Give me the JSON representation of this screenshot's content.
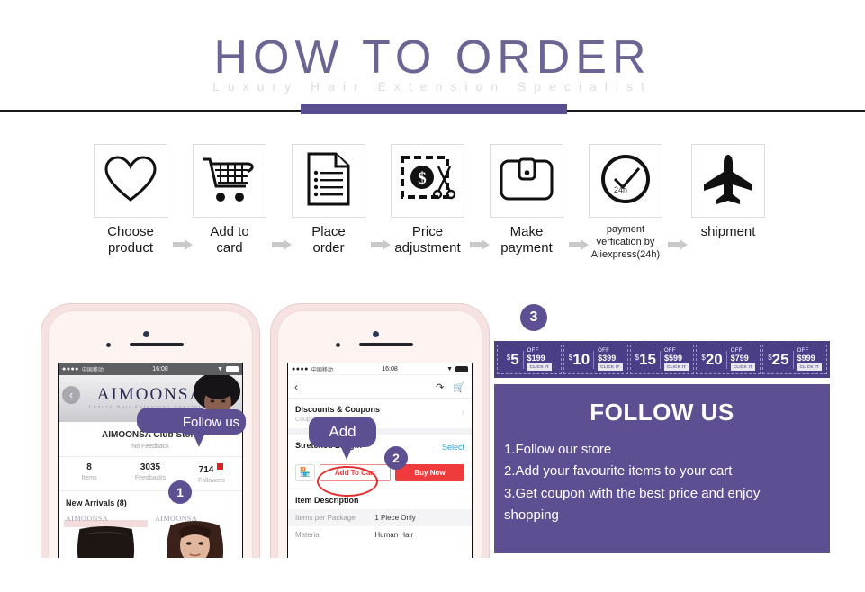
{
  "header": {
    "title": "HOW TO ORDER",
    "subtitle": "Luxury Hair Extension Specialist"
  },
  "steps": [
    {
      "icon": "heart-icon",
      "label_line1": "Choose",
      "label_line2": "product"
    },
    {
      "icon": "cart-icon",
      "label_line1": "Add to",
      "label_line2": "card"
    },
    {
      "icon": "document-icon",
      "label_line1": "Place",
      "label_line2": "order"
    },
    {
      "icon": "price-cut-icon",
      "label_line1": "Price",
      "label_line2": "adjustment"
    },
    {
      "icon": "wallet-icon",
      "label_line1": "Make",
      "label_line2": "payment"
    },
    {
      "icon": "clock-check-icon",
      "label_line1": "payment",
      "label_line2": "verfication by",
      "label_line3": "Aliexpress(24h)",
      "inner_text": "24h"
    },
    {
      "icon": "airplane-icon",
      "label_line1": "shipment",
      "label_line2": ""
    }
  ],
  "phone1": {
    "status_bar": {
      "dots": "●●●●",
      "carrier": "中国移动",
      "time": "16:08",
      "wifi": "▼"
    },
    "hero": {
      "back_icon": "back-chevron-icon",
      "brand": "AIMOONSA",
      "brand_sub": "Luxury Hair Extension Specialist"
    },
    "store_name": "AIMOONSA Club Store",
    "feedback": "No Feedback",
    "stats": [
      {
        "num": "8",
        "cap": "Items"
      },
      {
        "num": "3035",
        "cap": "Feedbacks"
      },
      {
        "num": "714",
        "cap": "Followers"
      }
    ],
    "new_arrivals": "New Arrivals (8)",
    "tile_watermark": "AIMOONSA",
    "bubble": "Follow us",
    "step_number": "1"
  },
  "phone2": {
    "status_bar": {
      "dots": "●●●●",
      "carrier": "中国移动",
      "time": "16:08",
      "wifi": "▼"
    },
    "back_icon": "back-chevron-icon",
    "share_icon": "share-icon",
    "cart_icon": "cart-icon",
    "discounts_title": "Discounts & Coupons",
    "discounts_sub": "Coupons",
    "stretched_title": "Stretched Length",
    "select_label": "Select",
    "shop_icon": "shop-icon",
    "add_to_cart": "Add To Cart",
    "buy_now": "Buy Now",
    "item_description": "Item Description",
    "desc_rows": [
      {
        "key": "Items per Package",
        "value": "1 Piece Only"
      },
      {
        "key": "Material",
        "value": "Human Hair"
      }
    ],
    "bubble": "Add",
    "step_number": "2"
  },
  "right_panel": {
    "step_number": "3",
    "coupons": [
      {
        "amount": "5",
        "currency": "$",
        "off": "OFF",
        "min": "$199",
        "action": "CLICK IT"
      },
      {
        "amount": "10",
        "currency": "$",
        "off": "OFF",
        "min": "$399",
        "action": "CLICK IT"
      },
      {
        "amount": "15",
        "currency": "$",
        "off": "OFF",
        "min": "$599",
        "action": "CLICK IT"
      },
      {
        "amount": "20",
        "currency": "$",
        "off": "OFF",
        "min": "$799",
        "action": "CLICK IT"
      },
      {
        "amount": "25",
        "currency": "$",
        "off": "OFF",
        "min": "$999",
        "action": "CLICK IT"
      }
    ],
    "follow_title": "FOLLOW US",
    "follow_lines": [
      "1.Follow our store",
      "2.Add your favourite items to your cart",
      "3.Get coupon with the best price and enjoy",
      "shopping"
    ]
  },
  "colors": {
    "purple": "#5d4f91",
    "coupon_purple": "#4a3e87",
    "title_purple": "#6b6594",
    "red": "#ef3b3b",
    "subtitle_grey": "#dcdce2"
  }
}
